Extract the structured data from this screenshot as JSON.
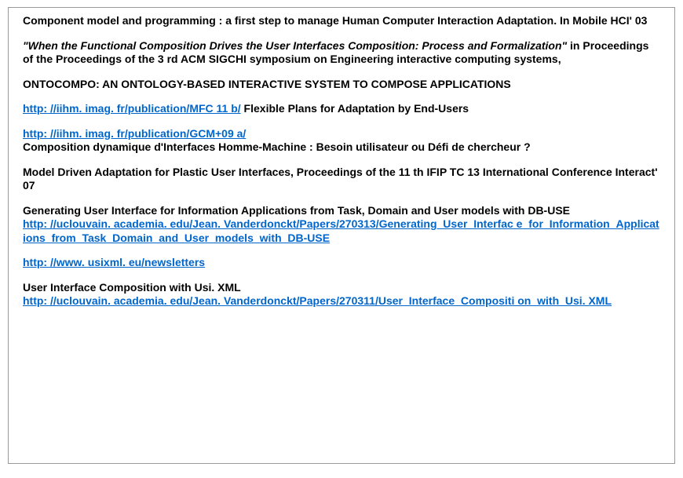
{
  "entries": {
    "e1": "Component model and programming : a first step to manage Human Computer Interaction Adaptation. In Mobile HCI' 03",
    "e2_italic": "\"When the Functional Composition Drives the User Interfaces Composition: Process and Formalization\"",
    "e2_plain": " in Proceedings of the Proceedings of the 3 rd ACM SIGCHI symposium on Engineering interactive computing systems,",
    "e3": "ONTOCOMPO: AN ONTOLOGY-BASED INTERACTIVE SYSTEM TO COMPOSE APPLICATIONS",
    "e4_link": "http: //iihm. imag. fr/publication/MFC 11 b/",
    "e4_after": " Flexible Plans for Adaptation by End-Users",
    "e5_link": "http: //iihm. imag. fr/publication/GCM+09 a/",
    "e5_after": " Composition dynamique d'Interfaces Homme-Machine : Besoin utilisateur ou Défi de chercheur ?",
    "e6": "Model Driven Adaptation for Plastic User Interfaces, Proceedings of the 11 th IFIP TC 13 International Conference Interact' 07",
    "e7_text": "Generating User Interface for Information Applications from Task, Domain and User models with DB-USE",
    "e7_link": "http: //uclouvain. academia. edu/Jean. Vanderdonckt/Papers/270313/Generating_User_Interfac e_for_Information_Applications_from_Task_Domain_and_User_models_with_DB-USE",
    "e8_link": "http: //www. usixml. eu/newsletters",
    "e9_text": "User Interface Composition with Usi. XML",
    "e9_link": "http: //uclouvain. academia. edu/Jean. Vanderdonckt/Papers/270311/User_Interface_Compositi on_with_Usi. XML"
  }
}
